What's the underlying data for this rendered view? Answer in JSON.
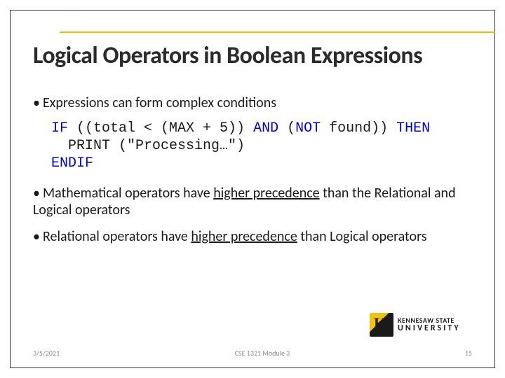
{
  "title": "Logical Operators in Boolean Expressions",
  "bullets": {
    "b1": "Expressions can form complex conditions",
    "b2a": "Mathematical operators have ",
    "b2u": "higher precedence",
    "b2b": " than the Relational and Logical operators",
    "b3a": "Relational operators have ",
    "b3u": "higher precedence",
    "b3b": " than Logical operators"
  },
  "code": {
    "if": "IF",
    "l1a": " ((total < (MAX + 5)) ",
    "and": "AND",
    "l1b": " (",
    "not": "NOT",
    "l1c": " found)) ",
    "then": "THEN",
    "l2": "  PRINT (\"Processing…\")",
    "endif": "ENDIF"
  },
  "footer": {
    "date": "3/5/2021",
    "center": "CSE 1321 Module 3",
    "page": "15"
  },
  "logo": {
    "line1": "KENNESAW STATE",
    "line2": "UNIVERSITY"
  }
}
